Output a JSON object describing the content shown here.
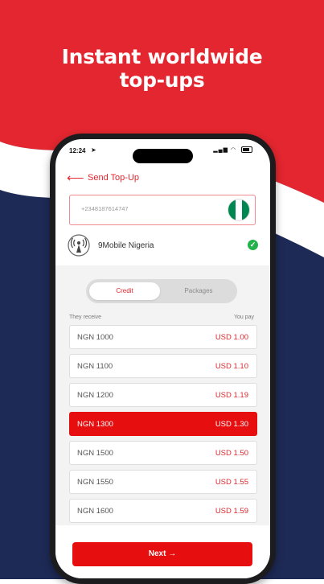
{
  "promo": {
    "headline_line1": "Instant worldwide",
    "headline_line2": "top-ups",
    "colors": {
      "red": "#e3262f",
      "navy": "#1e2a56",
      "white": "#ffffff"
    }
  },
  "status_bar": {
    "time": "12:24",
    "nav_icon": "location-arrow-icon",
    "signal_icon": "cellular-signal-icon",
    "wifi_icon": "wifi-icon",
    "battery_icon": "battery-icon"
  },
  "header": {
    "back_icon": "back-arrow-icon",
    "title": "Send Top-Up"
  },
  "phone_field": {
    "value": "+2348187614747",
    "flag_icon": "nigeria-flag-icon",
    "flag_colors": [
      "#008751",
      "#ffffff",
      "#008751"
    ]
  },
  "operator": {
    "icon": "broadcast-tower-icon",
    "name": "9Mobile Nigeria",
    "status_icon": "check-circle-icon"
  },
  "tabs": {
    "credit": "Credit",
    "packages": "Packages",
    "selected": "Credit"
  },
  "rates_table": {
    "col_receive": "They receive",
    "col_pay": "You pay",
    "rows": [
      {
        "receive": "NGN 1000",
        "pay": "USD 1.00",
        "selected": false
      },
      {
        "receive": "NGN 1100",
        "pay": "USD 1.10",
        "selected": false
      },
      {
        "receive": "NGN 1200",
        "pay": "USD 1.19",
        "selected": false
      },
      {
        "receive": "NGN 1300",
        "pay": "USD 1.30",
        "selected": true
      },
      {
        "receive": "NGN 1500",
        "pay": "USD 1.50",
        "selected": false
      },
      {
        "receive": "NGN 1550",
        "pay": "USD 1.55",
        "selected": false
      },
      {
        "receive": "NGN 1600",
        "pay": "USD 1.59",
        "selected": false
      }
    ]
  },
  "footer": {
    "next_label": "Next →"
  }
}
